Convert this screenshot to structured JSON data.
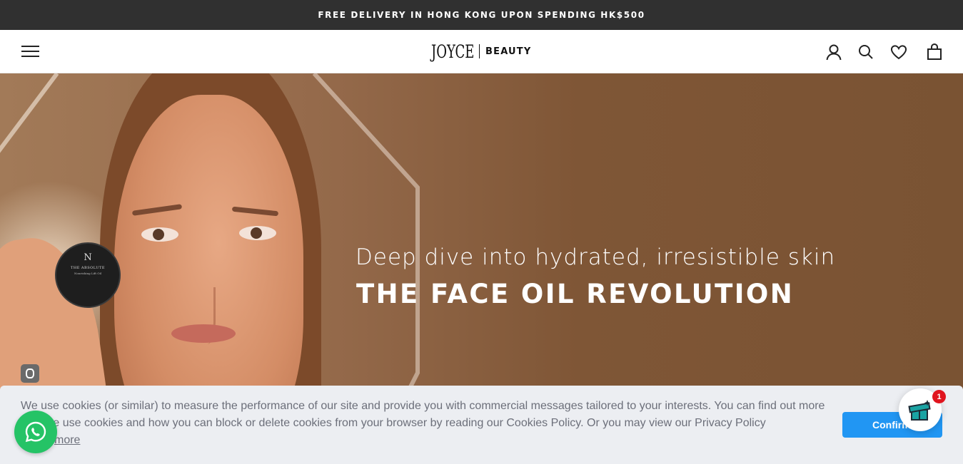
{
  "announcement": {
    "text": "FREE DELIVERY IN HONG KONG UPON SPENDING HK$500"
  },
  "header": {
    "logo_main": "JOYCE",
    "logo_sub": "BEAUTY",
    "icons": [
      "menu-icon",
      "account-icon",
      "search-icon",
      "heart-icon",
      "bag-icon"
    ]
  },
  "hero": {
    "line1": "Deep dive into hydrated, irresistible skin",
    "line2": "THE FACE OIL REVOLUTION",
    "product": {
      "mark": "N",
      "name": "THE ABSOLUTE",
      "desc": "Nourishing Lift Oil"
    }
  },
  "cookie": {
    "text": "We use cookies (or similar) to measure the performance of our site and provide you with commercial messages tailored to your interests. You can find out more how we use cookies and how you can block or delete cookies from your browser by reading our Cookies Policy. Or you may view our Privacy Policy",
    "more_label": "more",
    "confirm_label": "Confirm"
  },
  "gift_widget": {
    "count": "1"
  },
  "colors": {
    "announce_bg": "#303030",
    "hero_brown": "#7f5636",
    "confirm_blue": "#2196f3",
    "whatsapp_green": "#25c366",
    "badge_red": "#e0141e"
  }
}
